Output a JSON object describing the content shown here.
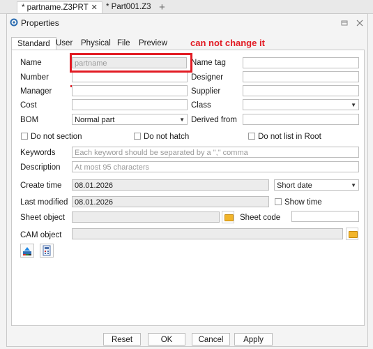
{
  "doc_tabs": [
    {
      "label": "* partname.Z3PRT",
      "close": "✕"
    },
    {
      "label": "* Part001.Z3"
    }
  ],
  "plus_label": "+",
  "dialog": {
    "title": "Properties",
    "tabs": [
      "Standard",
      "User",
      "Physical",
      "File",
      "Preview"
    ],
    "annotation": "can not change it",
    "fields": {
      "name_label": "Name",
      "name_value": "partname",
      "number_label": "Number",
      "manager_label": "Manager",
      "cost_label": "Cost",
      "bom_label": "BOM",
      "bom_value": "Normal part",
      "name_tag_label": "Name tag",
      "designer_label": "Designer",
      "supplier_label": "Supplier",
      "class_label": "Class",
      "derived_from_label": "Derived from",
      "do_not_section": "Do not section",
      "do_not_hatch": "Do not hatch",
      "do_not_list": "Do not list in Root",
      "keywords_label": "Keywords",
      "keywords_placeholder": "Each keyword should be separated by a \",\" comma",
      "description_label": "Description",
      "description_placeholder": "At most 95 characters",
      "create_time_label": "Create time",
      "create_time_value": "08.01.2026",
      "date_format_value": "Short date",
      "last_modified_label": "Last modified",
      "last_modified_value": "08.01.2026",
      "show_time_label": "Show time",
      "sheet_object_label": "Sheet object",
      "sheet_code_label": "Sheet code",
      "cam_object_label": "CAM object"
    },
    "buttons": {
      "reset": "Reset",
      "ok": "OK",
      "cancel": "Cancel",
      "apply": "Apply"
    }
  },
  "colors": {
    "annotation": "#e21b23",
    "folder": "#f2b52b"
  },
  "icons": [
    "close-icon",
    "plus-icon",
    "properties-icon",
    "pin-icon",
    "close-dialog-icon",
    "folder-icon",
    "chevron-down-icon",
    "paint-icon",
    "calculator-icon"
  ]
}
